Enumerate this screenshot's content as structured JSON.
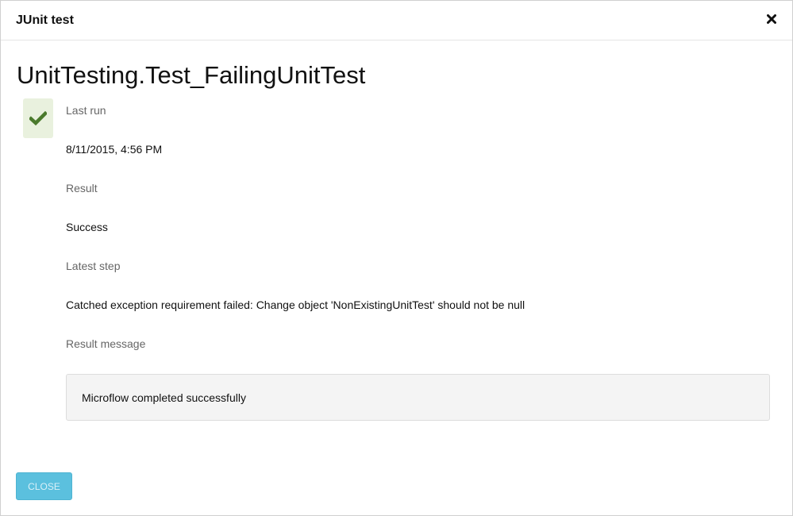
{
  "dialog": {
    "title": "JUnit test",
    "close_icon": "close-icon"
  },
  "test": {
    "name": "UnitTesting.Test_FailingUnitTest",
    "status_icon": "check-icon",
    "status_color": "#4a7a2c",
    "status_background": "#e9f1de",
    "fields": {
      "last_run_label": "Last run",
      "last_run_value": "8/11/2015, 4:56 PM",
      "result_label": "Result",
      "result_value": "Success",
      "latest_step_label": "Latest step",
      "latest_step_value": "Catched exception requirement failed: Change object 'NonExistingUnitTest' should not be null",
      "result_message_label": "Result message",
      "result_message_value": "Microflow completed successfully"
    }
  },
  "footer": {
    "close_button_label": "CLOSE",
    "close_button_color": "#5bc0de"
  }
}
